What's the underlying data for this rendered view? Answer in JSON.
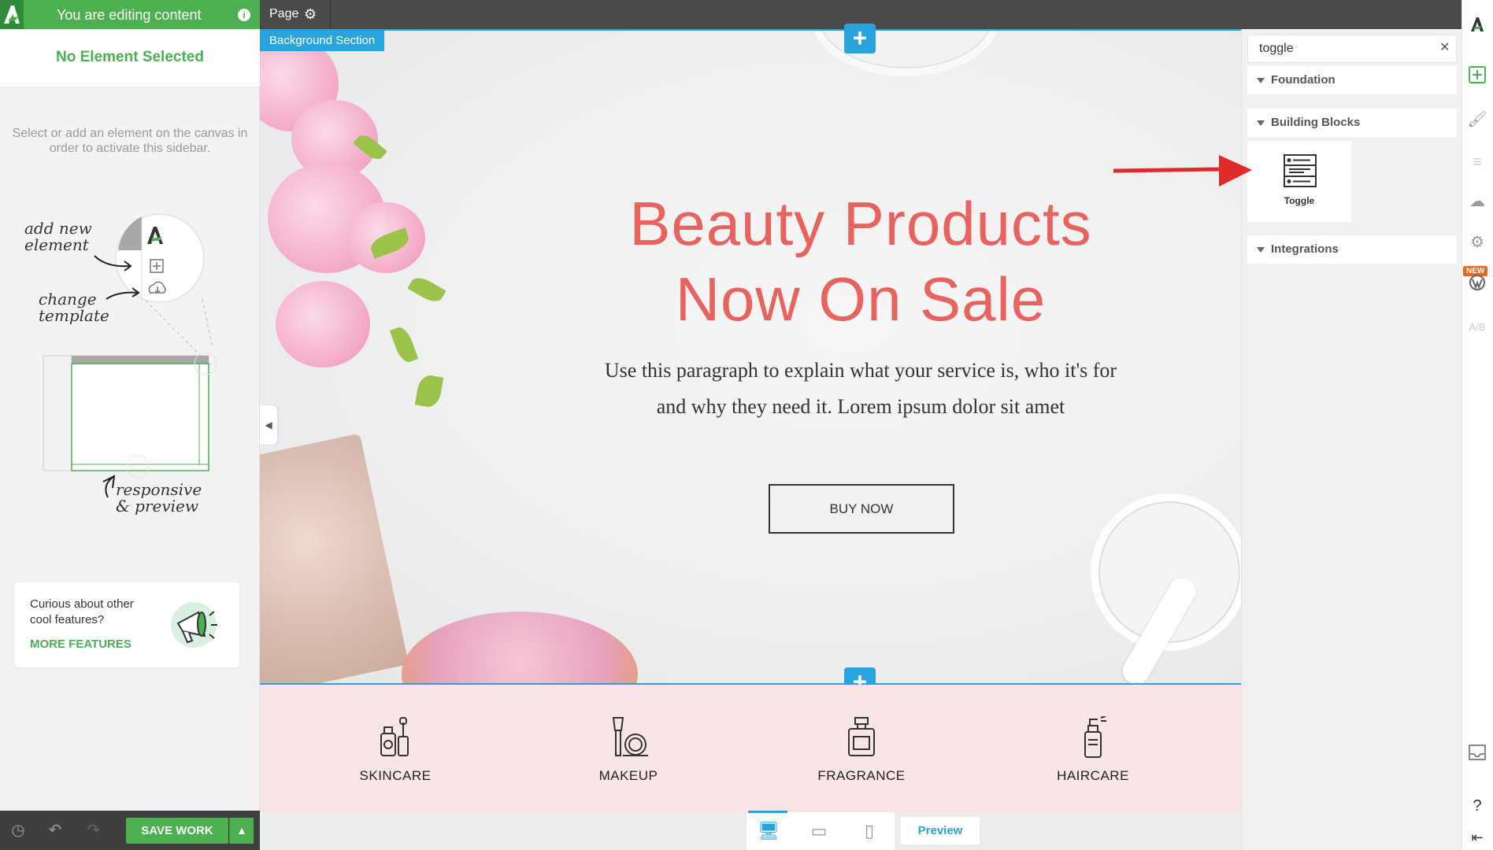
{
  "left_sidebar": {
    "editing_banner": "You are editing content",
    "no_element": "No Element Selected",
    "hint": "Select or add an element on the canvas in order to activate this sidebar.",
    "illustration": {
      "add_new": [
        "add new",
        "element"
      ],
      "change": [
        "change",
        "template"
      ],
      "responsive": [
        "responsive",
        "& preview"
      ]
    },
    "features": {
      "text": "Curious about other cool features?",
      "link": "MORE FEATURES"
    },
    "save_label": "SAVE WORK"
  },
  "topbar": {
    "page_label": "Page"
  },
  "canvas": {
    "section_tag": "Background Section",
    "title_line1": "Beauty Products",
    "title_line2": "Now On Sale",
    "paragraph_line1": "Use this paragraph to explain what your service is, who it's for",
    "paragraph_line2": "and why they need it. Lorem ipsum dolor sit amet",
    "button_label": "BUY NOW",
    "categories": [
      {
        "label": "SKINCARE",
        "icon": "skincare-bottles-icon"
      },
      {
        "label": "MAKEUP",
        "icon": "makeup-brush-icon"
      },
      {
        "label": "FRAGRANCE",
        "icon": "perfume-bottle-icon"
      },
      {
        "label": "HAIRCARE",
        "icon": "spray-bottle-icon"
      }
    ]
  },
  "bottom_bar": {
    "preview_label": "Preview"
  },
  "right_panel": {
    "search_value": "toggle",
    "sections": [
      "Foundation",
      "Building Blocks",
      "Integrations"
    ],
    "result_label": "Toggle"
  },
  "rail": {
    "new_badge": "NEW",
    "ab_label": "A/B"
  },
  "colors": {
    "accent_green": "#4caf50",
    "accent_blue": "#29a3dd",
    "title_coral": "#e8625e",
    "arrow_red": "#e02a2a"
  }
}
